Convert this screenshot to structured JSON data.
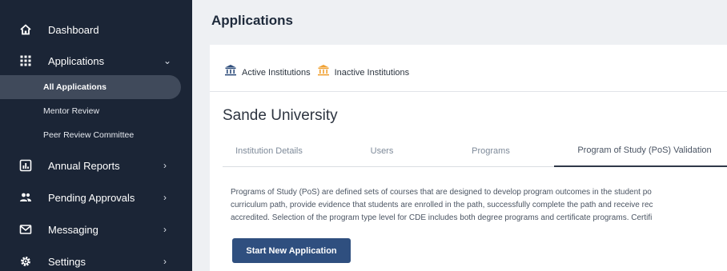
{
  "sidebar": {
    "items": [
      {
        "label": "Dashboard",
        "icon": "home-icon"
      },
      {
        "label": "Applications",
        "icon": "grid-icon",
        "chevron": "⌄"
      },
      {
        "label": "Annual Reports",
        "icon": "chart-icon",
        "chevron": "›"
      },
      {
        "label": "Pending Approvals",
        "icon": "users-icon",
        "chevron": "›"
      },
      {
        "label": "Messaging",
        "icon": "mail-icon",
        "chevron": "›"
      },
      {
        "label": "Settings",
        "icon": "gear-icon",
        "chevron": "›"
      }
    ],
    "subitems": [
      {
        "label": "All Applications",
        "active": true
      },
      {
        "label": "Mentor Review"
      },
      {
        "label": "Peer Review Committee"
      }
    ]
  },
  "main": {
    "title": "Applications",
    "institution_tabs": [
      {
        "label": "Active Institutions",
        "icon": "institution-icon",
        "color": "#2e4d7b"
      },
      {
        "label": "Inactive Institutions",
        "icon": "institution-icon",
        "color": "#f0a030"
      }
    ],
    "university": "Sande University",
    "tabs": [
      {
        "label": "Institution Details"
      },
      {
        "label": "Users"
      },
      {
        "label": "Programs"
      },
      {
        "label": "Program of Study (PoS) Validation",
        "active": true
      }
    ],
    "description": [
      "Programs of Study (PoS) are defined sets of courses that are designed to develop program outcomes in the student po",
      "curriculum path, provide evidence that students are enrolled in the path, successfully complete the path and receive rec",
      "accredited. Selection of the program type level for CDE includes both degree programs and certificate programs. Certifi"
    ],
    "start_button": "Start New Application"
  },
  "colors": {
    "sidebar_bg": "#1b2536",
    "active_sub_bg": "#404a5b",
    "button_bg": "#2f4f7f",
    "active_institution_icon": "#2e4d7b",
    "inactive_institution_icon": "#f0a030"
  }
}
